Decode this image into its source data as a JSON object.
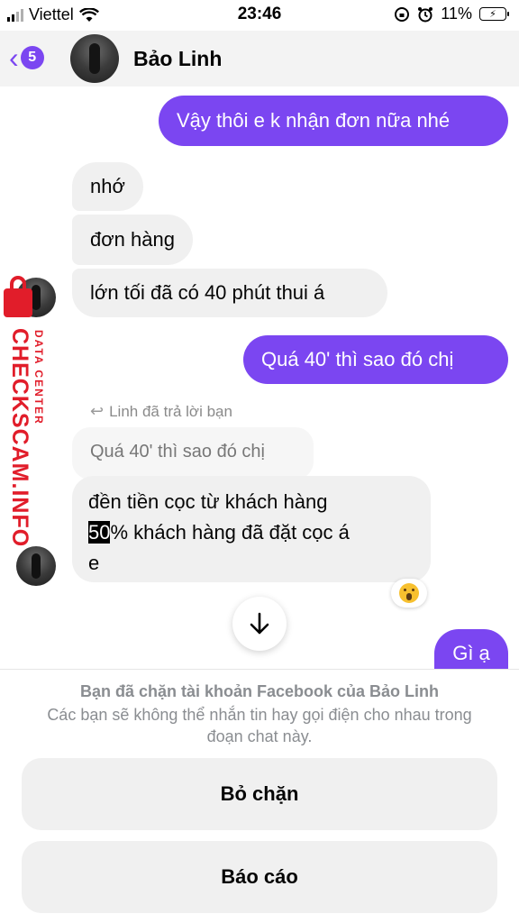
{
  "status_bar": {
    "carrier": "Viettel",
    "time": "23:46",
    "battery": "11%",
    "icons": [
      "signal-icon",
      "wifi-icon",
      "rotation-lock-icon",
      "alarm-icon",
      "battery-charging-icon"
    ]
  },
  "header": {
    "back_count": "5",
    "contact_name": "Bảo Linh",
    "icons": [
      "chevron-left-icon",
      "avatar"
    ]
  },
  "messages": {
    "m1": "Vậy thôi e k nhận đơn nữa nhé",
    "m2": "nhớ",
    "m3": "đơn hàng",
    "m4": "lớn tối đã có 40 phút thui á",
    "m5": "Quá 40' thì sao đó chị",
    "reply_note": "Linh đã trả lời bạn",
    "quoted": "Quá 40' thì sao đó chị",
    "m6_line1": "đền  tiền cọc từ khách hàng",
    "m6_highlight": "50",
    "m6_line2_rest": "%  khách hàng đã đặt cọc á",
    "m6_line3": "e",
    "m7": "Gì ạ"
  },
  "watermark": {
    "main": "CHECKSCAM.INFO",
    "sub": "DATA CENTER"
  },
  "blocked_panel": {
    "title": "Bạn đã chặn tài khoản Facebook của Bảo Linh",
    "description": "Các bạn sẽ không thể nhắn tin hay gọi điện cho nhau trong đoạn chat này.",
    "unblock_label": "Bỏ chặn",
    "report_label": "Báo cáo"
  },
  "colors": {
    "accent": "#7b46f1",
    "incoming_bubble": "#f0f0f0",
    "watermark": "#e11d2a"
  }
}
